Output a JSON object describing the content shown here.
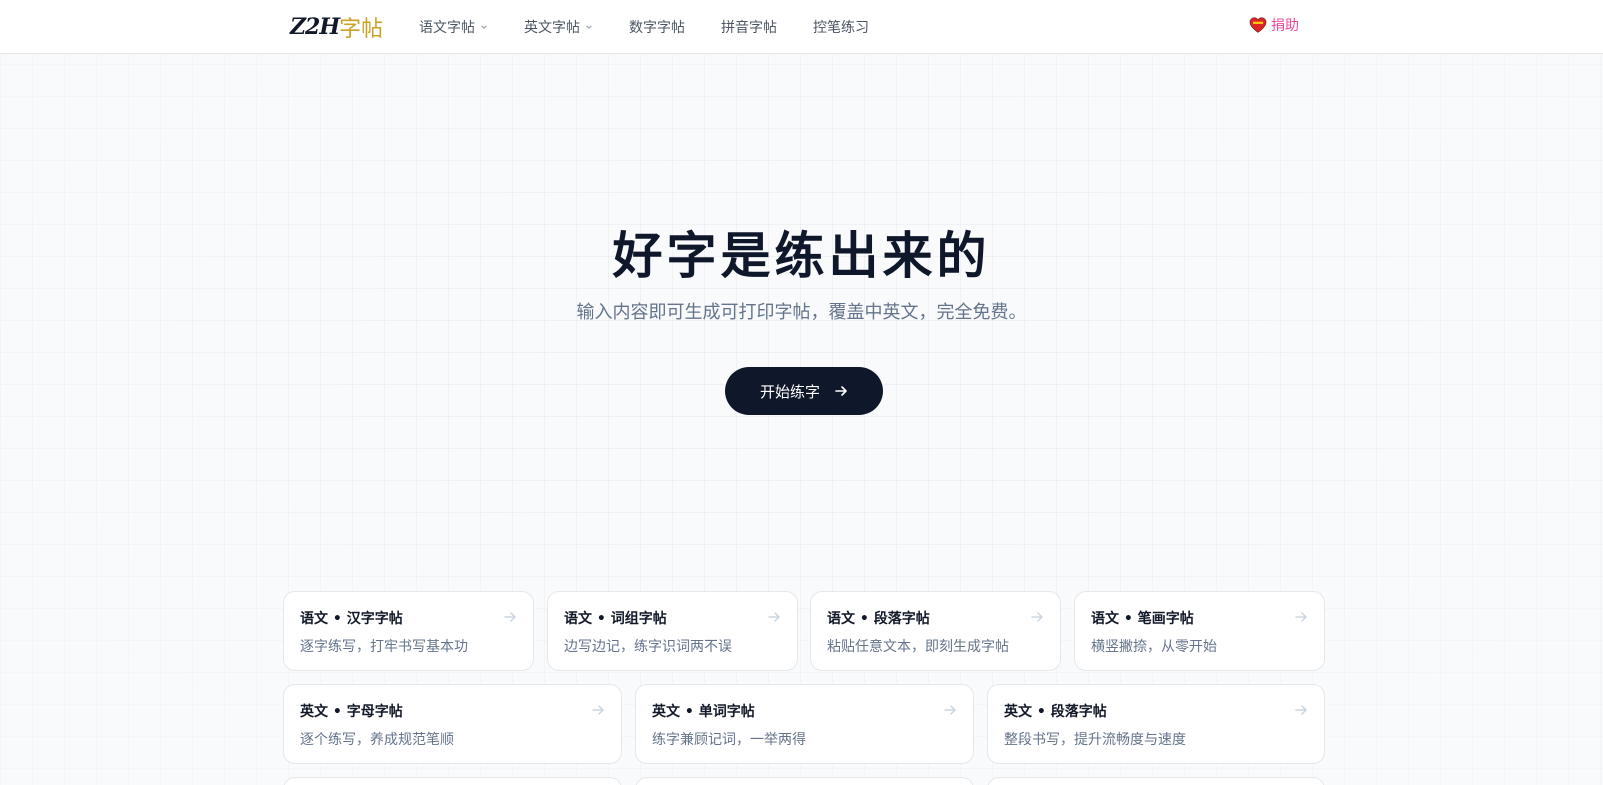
{
  "header": {
    "logo": {
      "main": "Z2H",
      "suffix": "字帖"
    },
    "nav": [
      {
        "label": "语文字帖",
        "has_dropdown": true
      },
      {
        "label": "英文字帖",
        "has_dropdown": true
      },
      {
        "label": "数字字帖",
        "has_dropdown": false
      },
      {
        "label": "拼音字帖",
        "has_dropdown": false
      },
      {
        "label": "控笔练习",
        "has_dropdown": false
      }
    ],
    "donate_label": "捐助",
    "donate_icon": "heart-icon"
  },
  "hero": {
    "title": "好字是练出来的",
    "subtitle": "输入内容即可生成可打印字帖，覆盖中英文，完全免费。",
    "cta_label": "开始练字",
    "cta_icon": "arrow-right-icon"
  },
  "cards_row1": [
    {
      "title": "语文 • 汉字字帖",
      "desc": "逐字练写，打牢书写基本功"
    },
    {
      "title": "语文 • 词组字帖",
      "desc": "边写边记，练字识词两不误"
    },
    {
      "title": "语文 • 段落字帖",
      "desc": "粘贴任意文本，即刻生成字帖"
    },
    {
      "title": "语文 • 笔画字帖",
      "desc": "横竖撇捺，从零开始"
    }
  ],
  "cards_row2": [
    {
      "title": "英文 • 字母字帖",
      "desc": "逐个练写，养成规范笔顺"
    },
    {
      "title": "英文 • 单词字帖",
      "desc": "练字兼顾记词，一举两得"
    },
    {
      "title": "英文 • 段落字帖",
      "desc": "整段书写，提升流畅度与速度"
    }
  ],
  "colors": {
    "primary": "#0f172a",
    "accent_pink": "#ec4899",
    "muted_text": "#64748b",
    "nav_text": "#4b5563"
  }
}
